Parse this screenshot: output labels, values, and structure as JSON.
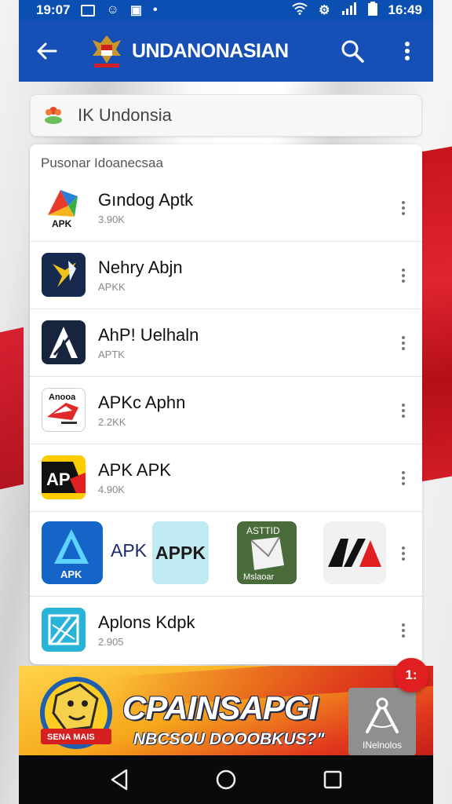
{
  "status_bar": {
    "time_left": "19:07",
    "time_right": "16:49"
  },
  "app_bar": {
    "title": "UNDANONASIAN"
  },
  "search": {
    "value": "IK Undonsia"
  },
  "list": {
    "header": "Pusonar Idoanecsaa",
    "rows": [
      {
        "name": "Gındog Aptk",
        "sub": "3.90K",
        "icon_label": "APK"
      },
      {
        "name": "Nehry Abjn",
        "sub": "APKK",
        "icon_label": ""
      },
      {
        "name": "AhP! Uelhaln",
        "sub": "APTK",
        "icon_label": ""
      },
      {
        "name": "APKc Aphn",
        "sub": "2.2KK",
        "icon_label": "Anooa"
      },
      {
        "name": "APK APK",
        "sub": "4.90K",
        "icon_label": "AP"
      },
      {
        "name": "Aplons Kdpk",
        "sub": "2.905",
        "icon_label": ""
      }
    ],
    "wide_row": {
      "icon1_label": "APK",
      "text1": "APK",
      "text2": "APPK",
      "icon3_top": "ASTTID",
      "icon3_bottom": "Mslaoar",
      "icon4_label": "AA"
    }
  },
  "ad": {
    "title": "CPAINSAPGI",
    "subtitle": "NBCSOU DOOOBKUS?\"",
    "tile_label": "INelnolos",
    "badge": "1:",
    "logo_ribbon": "SENA MAIS"
  },
  "colors": {
    "app_bar": "#1650b7",
    "status_bar": "#0b4fb3",
    "accent_red": "#e02020"
  }
}
